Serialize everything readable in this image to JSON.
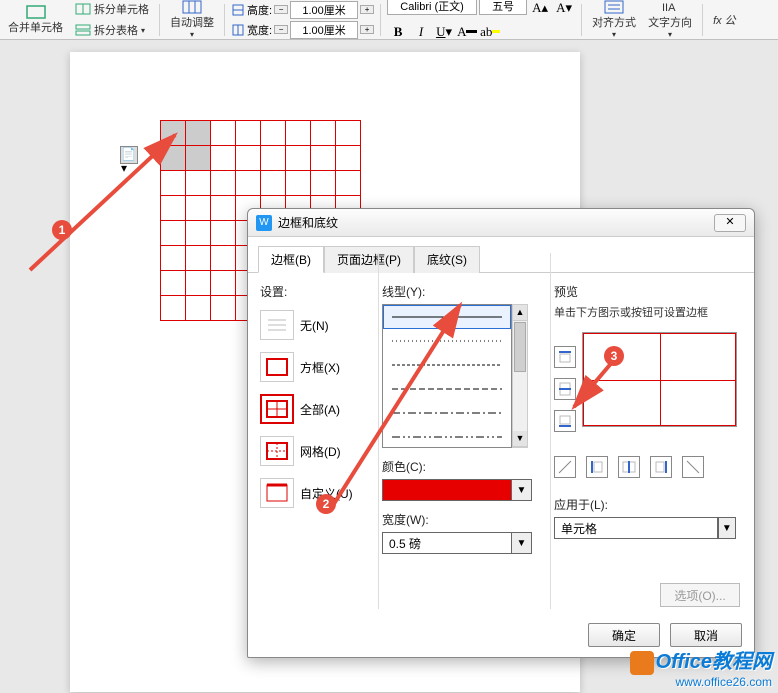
{
  "ribbon": {
    "merge_cells": "合并单元格",
    "split_cells": "拆分单元格",
    "split_table": "拆分表格",
    "auto_fit": "自动调整",
    "height_label": "高度:",
    "height_value": "1.00厘米",
    "width_label": "宽度:",
    "width_value": "1.00厘米",
    "font_name": "Calibri (正文)",
    "font_size": "五号",
    "alignment": "对齐方式",
    "text_direction": "文字方向",
    "fx": "fx 公"
  },
  "annotations": {
    "a1": "1",
    "a2": "2",
    "a3": "3"
  },
  "dialog": {
    "title": "边框和底纹",
    "tabs": {
      "border": "边框(B)",
      "page_border": "页面边框(P)",
      "shading": "底纹(S)"
    },
    "settings_label": "设置:",
    "settings": {
      "none": "无(N)",
      "box": "方框(X)",
      "all": "全部(A)",
      "grid": "网格(D)",
      "custom": "自定义(U)"
    },
    "line_style_label": "线型(Y):",
    "color_label": "颜色(C):",
    "color_value": "#e60000",
    "width_label": "宽度(W):",
    "width_value": "0.5  磅",
    "preview_label": "预览",
    "preview_hint": "单击下方图示或按钮可设置边框",
    "apply_to_label": "应用于(L):",
    "apply_to_value": "单元格",
    "options_btn": "选项(O)...",
    "ok": "确定",
    "cancel": "取消"
  },
  "watermark": {
    "brand": "Office教程网",
    "url": "www.office26.com"
  }
}
